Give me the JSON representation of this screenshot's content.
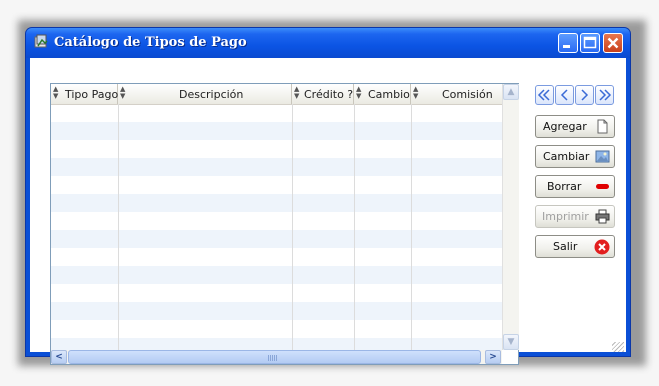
{
  "window": {
    "title": "Catálogo de Tipos de Pago",
    "controls": [
      "minimize-icon",
      "maximize-icon",
      "close-icon"
    ],
    "accent_color": "#0a4fd6"
  },
  "grid": {
    "columns": [
      {
        "key": "tipo_pago",
        "label": "Tipo Pago"
      },
      {
        "key": "descripcion",
        "label": "Descripción"
      },
      {
        "key": "credito",
        "label": "Crédito ?"
      },
      {
        "key": "cambio",
        "label": "Cambio"
      },
      {
        "key": "comision",
        "label": "Comisión"
      }
    ],
    "rows": []
  },
  "navigation": [
    "first-icon",
    "previous-icon",
    "next-icon",
    "last-icon"
  ],
  "actions": {
    "add_label": "Agregar",
    "edit_label": "Cambiar",
    "delete_label": "Borrar",
    "print_label": "Imprimir",
    "exit_label": "Salir",
    "print_enabled": false
  }
}
